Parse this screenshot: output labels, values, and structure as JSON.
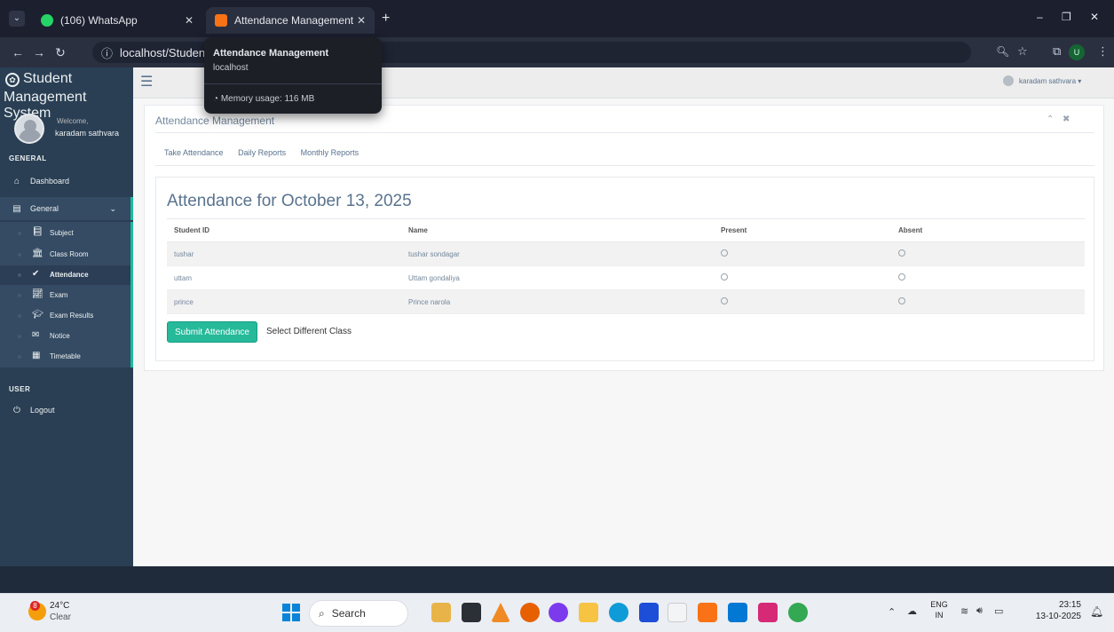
{
  "browser": {
    "tabs": [
      {
        "title": "(106) WhatsApp",
        "active": false
      },
      {
        "title": "Attendance Management",
        "active": true
      }
    ],
    "new_tab": "+",
    "url": "localhost/Student-",
    "tooltip": {
      "title": "Attendance Management",
      "host": "localhost",
      "memory": "Memory usage: 116 MB"
    },
    "profile_initial": "U",
    "window_controls": [
      "–",
      "❐",
      "✕"
    ]
  },
  "sidebar": {
    "brand_line1": "Student",
    "brand_line2": "Management System",
    "welcome": "Welcome,",
    "user_name": "karadam sathvara",
    "section_general": "GENERAL",
    "dashboard": "Dashboard",
    "general_menu": "General",
    "sub_items": [
      "Subject",
      "Class Room",
      "Attendance",
      "Exam",
      "Exam Results",
      "Notice",
      "Timetable"
    ],
    "section_user": "USER",
    "logout": "Logout"
  },
  "topnav": {
    "user": "karadam sathvara"
  },
  "panel": {
    "title": "Attendance Management",
    "tabs": [
      "Take Attendance",
      "Daily Reports",
      "Monthly Reports"
    ],
    "attendance_title": "Attendance for October 13, 2025",
    "columns": [
      "Student ID",
      "Name",
      "Present",
      "Absent"
    ],
    "rows": [
      {
        "id": "tushar",
        "name": "tushar sondagar"
      },
      {
        "id": "uttam",
        "name": "Uttam gondaliya"
      },
      {
        "id": "prince",
        "name": "Prince narola"
      }
    ],
    "submit_label": "Submit Attendance",
    "select_class_label": "Select Different Class"
  },
  "taskbar": {
    "weather_temp": "24°C",
    "weather_desc": "Clear",
    "weather_badge": "8",
    "search": "Search",
    "lang1": "ENG",
    "lang2": "IN",
    "time": "23:15",
    "date": "13-10-2025"
  }
}
